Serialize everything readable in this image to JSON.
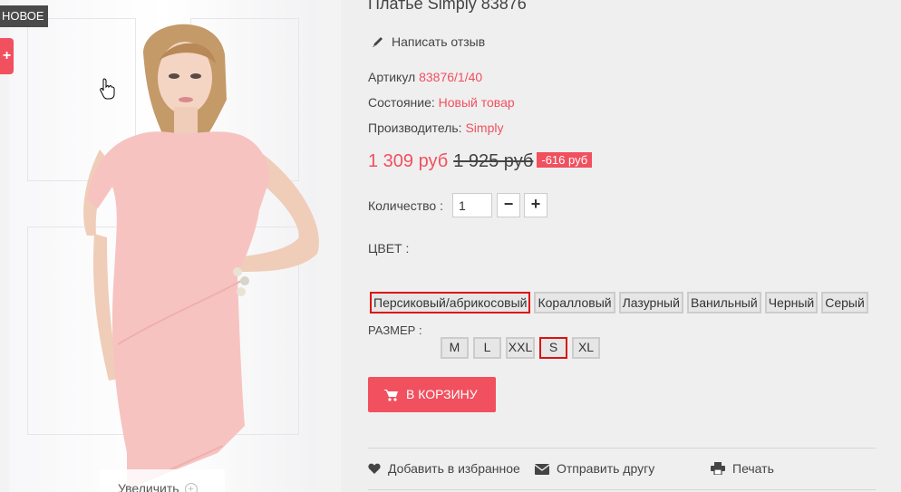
{
  "product": {
    "title": "Платье Simply 83876",
    "badge_new": "НОВОЕ",
    "plus_symbol": "+",
    "zoom_label": "Увеличить",
    "review_link": "Написать отзыв",
    "article_label": "Артикул",
    "article_value": "83876/1/40",
    "condition_label": "Состояние:",
    "condition_value": "Новый товар",
    "manufacturer_label": "Производитель:",
    "manufacturer_value": "Simply",
    "price": "1 309 руб",
    "old_price": "1 925 руб",
    "discount": "-616 руб",
    "quantity_label": "Количество :",
    "quantity_value": "1",
    "qty_minus": "−",
    "qty_plus": "+",
    "color_label": "ЦВЕТ :",
    "colors": [
      "Персиковый/абрикосовый",
      "Коралловый",
      "Лазурный",
      "Ванильный",
      "Черный",
      "Серый"
    ],
    "selected_color": "Персиковый/абрикосовый",
    "size_label": "РАЗМЕР :",
    "sizes": [
      "M",
      "L",
      "XXL",
      "S",
      "XL"
    ],
    "selected_size": "S",
    "cart_button": "В КОРЗИНУ",
    "actions": {
      "favorite": "Добавить в избранное",
      "send": "Отправить другу",
      "print": "Печать"
    }
  },
  "colors": {
    "accent": "#f1505f",
    "selected_border": "#dd1111",
    "badge_bg": "#4a4a4a",
    "dress": "#f7c3c0"
  },
  "icons": [
    "pencil-icon",
    "cart-icon",
    "heart-icon",
    "envelope-icon",
    "printer-icon",
    "hand-cursor-icon",
    "zoom-plus-icon"
  ]
}
